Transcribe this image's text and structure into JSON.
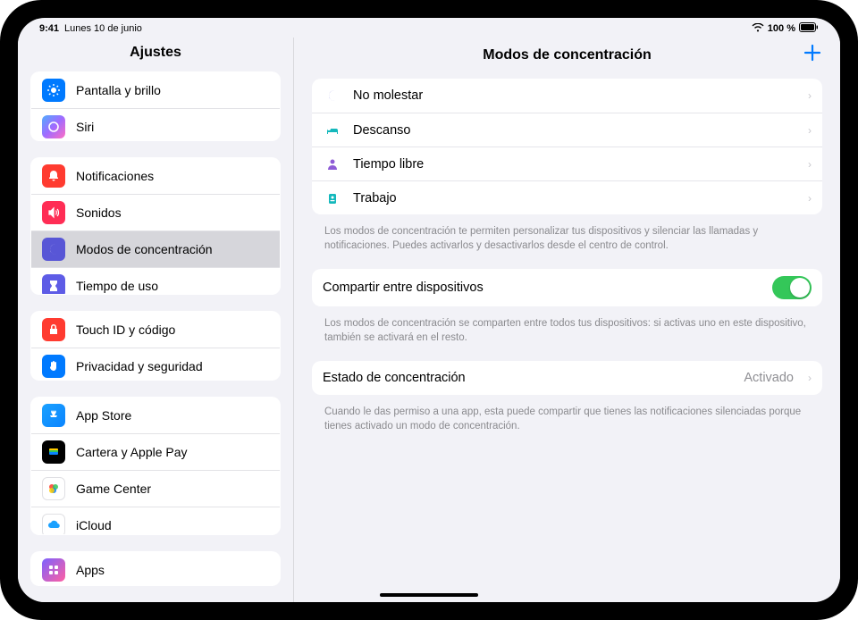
{
  "status": {
    "time": "9:41",
    "date": "Lunes 10 de junio",
    "battery": "100 %"
  },
  "sidebar": {
    "title": "Ajustes",
    "group0": [
      {
        "label": "Pantalla y brillo"
      },
      {
        "label": "Siri"
      }
    ],
    "group1": [
      {
        "label": "Notificaciones"
      },
      {
        "label": "Sonidos"
      },
      {
        "label": "Modos de concentración"
      },
      {
        "label": "Tiempo de uso"
      }
    ],
    "group2": [
      {
        "label": "Touch ID y código"
      },
      {
        "label": "Privacidad y seguridad"
      }
    ],
    "group3": [
      {
        "label": "App Store"
      },
      {
        "label": "Cartera y Apple Pay"
      },
      {
        "label": "Game Center"
      },
      {
        "label": "iCloud"
      }
    ],
    "group4": [
      {
        "label": "Apps"
      }
    ]
  },
  "detail": {
    "title": "Modos de concentración",
    "modes": [
      {
        "label": "No molestar",
        "icon_color": "#5856d6"
      },
      {
        "label": "Descanso",
        "icon_color": "#14b8bc"
      },
      {
        "label": "Tiempo libre",
        "icon_color": "#8e5bd6"
      },
      {
        "label": "Trabajo",
        "icon_color": "#14b8bc"
      }
    ],
    "modes_footer": "Los modos de concentración te permiten personalizar tus dispositivos y silenciar las llamadas y notificaciones. Puedes activarlos y desactivarlos desde el centro de control.",
    "share": {
      "label": "Compartir entre dispositivos",
      "on": true,
      "footer": "Los modos de concentración se comparten entre todos tus dispositivos: si activas uno en este dispositivo, también se activará en el resto."
    },
    "status": {
      "label": "Estado de concentración",
      "value": "Activado",
      "footer": "Cuando le das permiso a una app, esta puede compartir que tienes las notificaciones silenciadas porque tienes activado un modo de concentración."
    }
  }
}
